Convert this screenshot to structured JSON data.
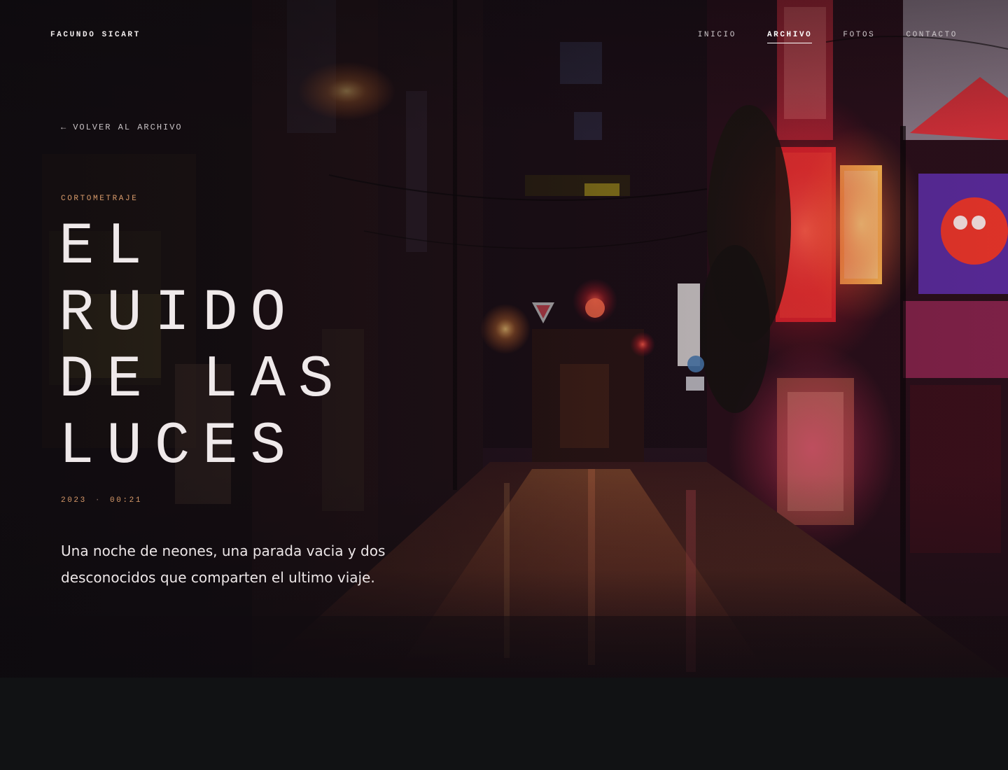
{
  "header": {
    "brand": "FACUNDO SICART",
    "nav": [
      {
        "label": "INICIO",
        "active": false
      },
      {
        "label": "ARCHIVO",
        "active": true
      },
      {
        "label": "FOTOS",
        "active": false
      },
      {
        "label": "CONTACTO",
        "active": false
      }
    ]
  },
  "hero": {
    "back_link": {
      "icon": "arrow-left-icon",
      "arrow": "←",
      "label": "VOLVER AL ARCHIVO"
    },
    "category": "CORTOMETRAJE",
    "title_lines": [
      "EL",
      "RUIDO",
      "DE LAS",
      "LUCES"
    ],
    "year": "2023",
    "separator": "·",
    "duration": "00:21",
    "synopsis": "Una noche de neones, una parada vacia y dos desconocidos que comparten el ultimo viaje."
  },
  "colors": {
    "accent": "#d79a6a",
    "text": "#efe9ea",
    "background": "#111214",
    "neon_red": "#e0232c"
  }
}
